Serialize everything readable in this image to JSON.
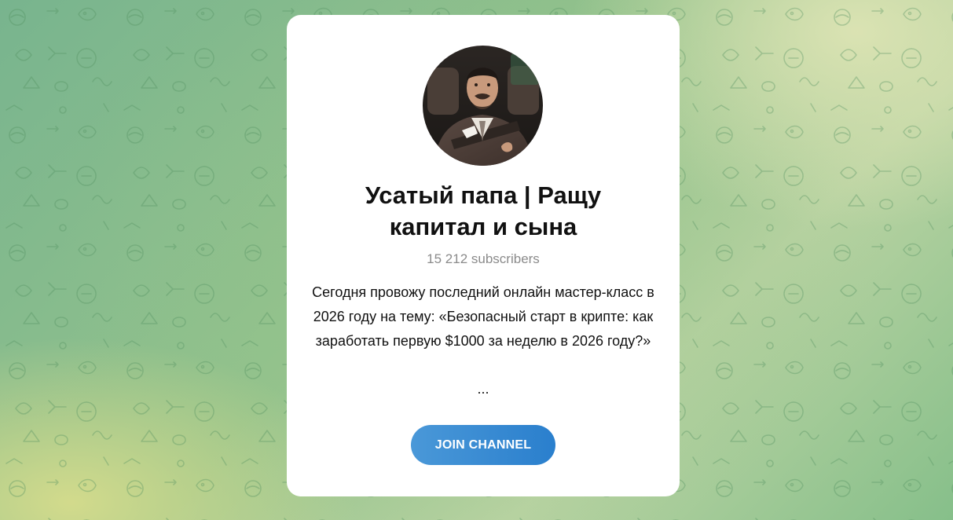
{
  "channel": {
    "title": "Усатый папа | Ращу капитал и сына",
    "subscribers": "15 212 subscribers",
    "description": "Сегодня провожу последний онлайн мастер-класс в 2026 году на тему: «Безопасный старт в крипте: как заработать первую $1000 за неделю в 2026 году?»",
    "ellipsis": "...",
    "avatar": "channel-avatar-photo"
  },
  "actions": {
    "join_label": "JOIN CHANNEL"
  },
  "colors": {
    "accent": "#2a7fcd",
    "accent_light": "#4a98d8",
    "card": "#ffffff",
    "subtle_text": "#8b8b8b",
    "background_green": "#86bf8a",
    "background_yellow": "#d6dc8c"
  }
}
